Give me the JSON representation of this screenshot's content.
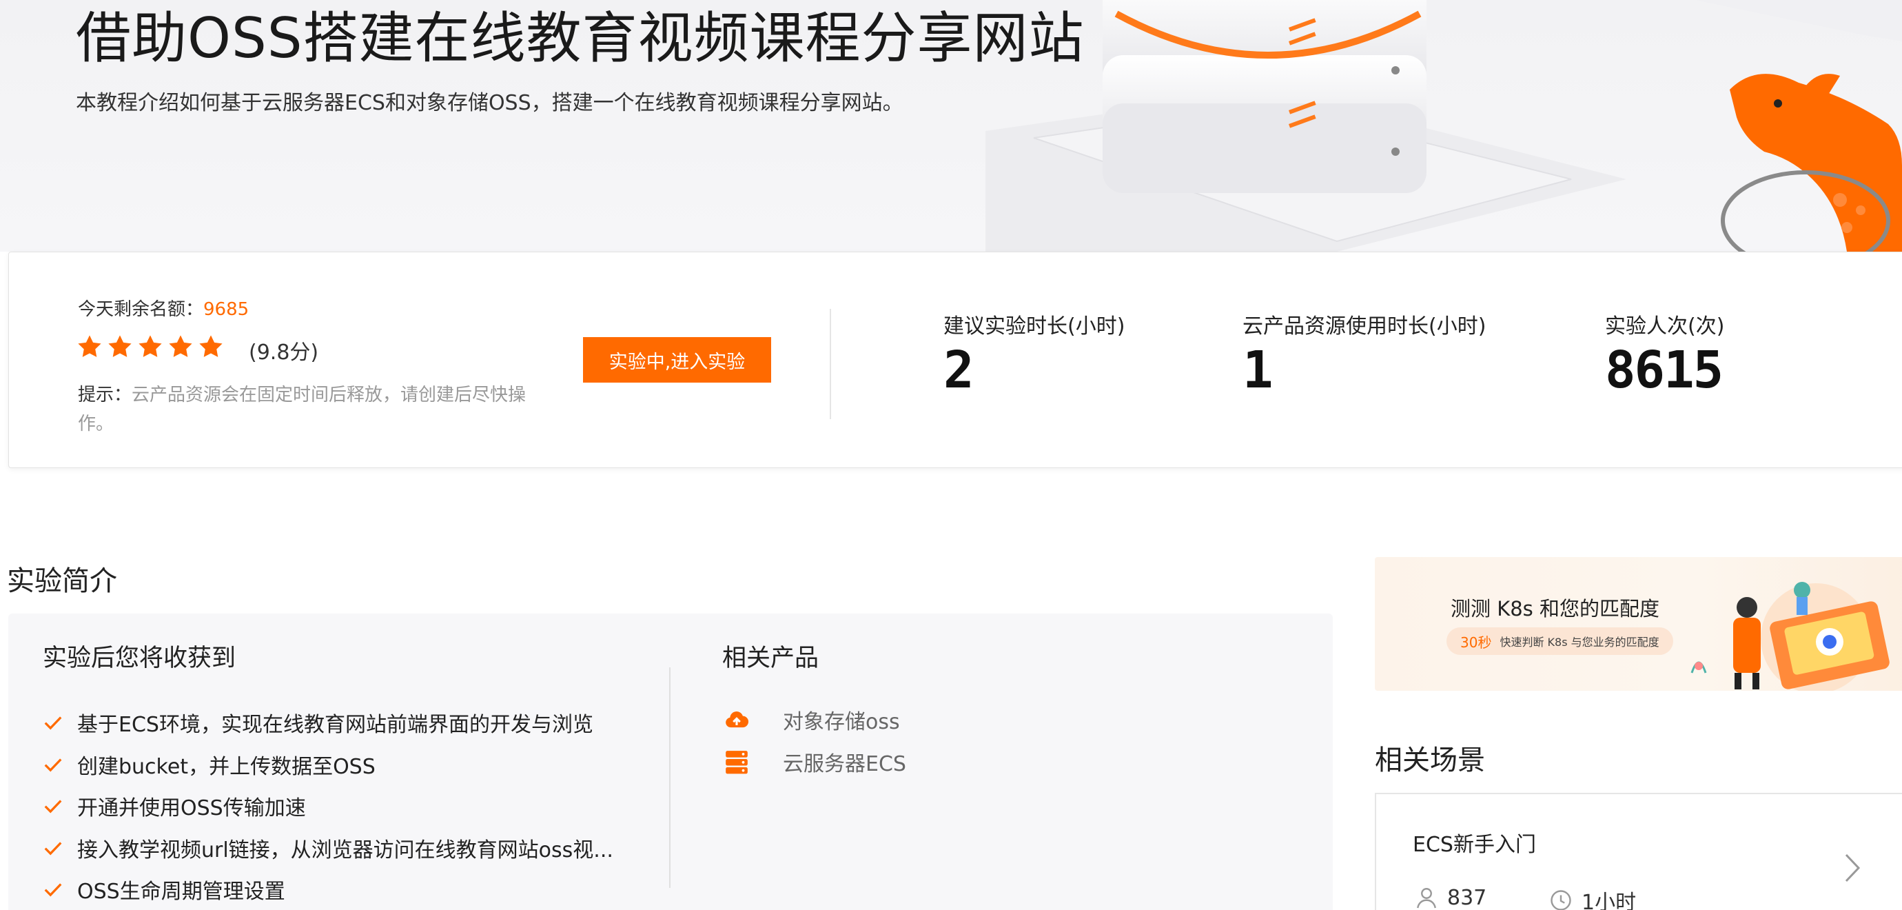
{
  "hero": {
    "title": "借助OSS搭建在线教育视频课程分享网站",
    "subtitle": "本教程介绍如何基于云服务器ECS和对象存储OSS，搭建一个在线教育视频课程分享网站。"
  },
  "stats_panel": {
    "quota_label": "今天剩余名额：",
    "quota_value": "9685",
    "rating_stars": 5,
    "score_text": "(9.8分)",
    "tip_label": "提示：",
    "tip_text": "云产品资源会在固定时间后释放，请创建后尽快操作。",
    "start_button": "实验中,进入实验",
    "metrics": [
      {
        "label": "建议实验时长(小时)",
        "value": "2"
      },
      {
        "label": "云产品资源使用时长(小时)",
        "value": "1"
      },
      {
        "label": "实验人次(次)",
        "value": "8615"
      }
    ]
  },
  "intro": {
    "section_title": "实验简介",
    "gains_title": "实验后您将收获到",
    "gains": [
      "基于ECS环境，实现在线教育网站前端界面的开发与浏览",
      "创建bucket，并上传数据至OSS",
      "开通并使用OSS传输加速",
      "接入教学视频url链接，从浏览器访问在线教育网站oss视...",
      "OSS生命周期管理设置"
    ],
    "products_title": "相关产品",
    "products": [
      {
        "name": "对象存储oss",
        "icon": "cloud-upload-icon"
      },
      {
        "name": "云服务器ECS",
        "icon": "server-icon"
      }
    ]
  },
  "banner": {
    "title": "测测 K8s 和您的匹配度",
    "pill_seconds": "30秒",
    "pill_text": "快速判断 K8s 与您业务的匹配度"
  },
  "related": {
    "title": "相关场景",
    "scene": {
      "name": "ECS新手入门",
      "users": "837",
      "duration": "1小时"
    }
  },
  "colors": {
    "accent": "#ff6a00",
    "text": "#222222",
    "muted": "#999999"
  }
}
